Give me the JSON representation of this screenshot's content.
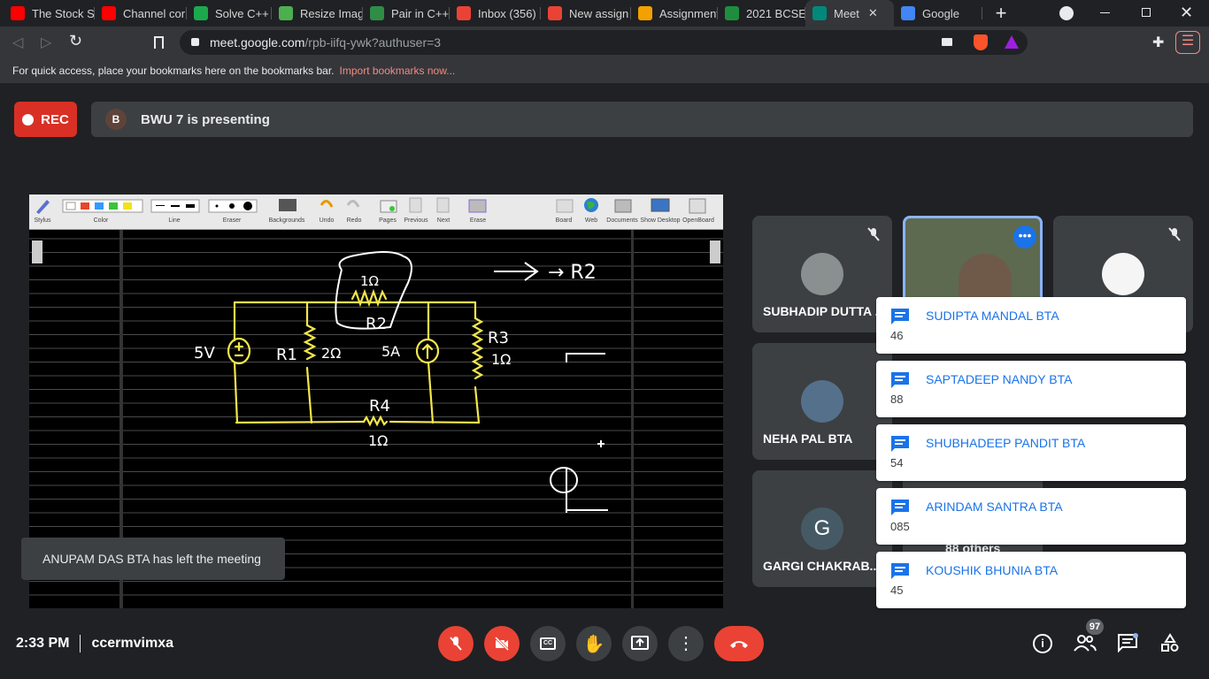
{
  "tabs": [
    {
      "label": "The Stock Sp",
      "icon": "youtube-icon",
      "color": "#ff0000"
    },
    {
      "label": "Channel cor",
      "icon": "youtube-icon",
      "color": "#ff0000"
    },
    {
      "label": "Solve C++ |",
      "icon": "hackerrank-icon",
      "color": "#1ba94c"
    },
    {
      "label": "Resize Imag",
      "icon": "resize-icon",
      "color": "#4caf50"
    },
    {
      "label": "Pair in C++",
      "icon": "gfg-icon",
      "color": "#2f8d46"
    },
    {
      "label": "Inbox (356)",
      "icon": "gmail-icon",
      "color": "#ea4335"
    },
    {
      "label": "New assign",
      "icon": "gmail-icon",
      "color": "#ea4335"
    },
    {
      "label": "Assignment",
      "icon": "classroom-icon",
      "color": "#f4a000"
    },
    {
      "label": "2021 BCSE-",
      "icon": "classroom-icon",
      "color": "#1e8e3e"
    },
    {
      "label": "Meet",
      "icon": "meet-icon",
      "color": "#00897b"
    },
    {
      "label": "Google",
      "icon": "google-icon",
      "color": "#4285f4"
    }
  ],
  "address": {
    "domain": "meet.google.com",
    "path": "/rpb-iifq-ywk?authuser=3"
  },
  "bookmarks": {
    "text": "For quick access, place your bookmarks here on the bookmarks bar.",
    "link": "Import bookmarks now..."
  },
  "meeting": {
    "rec_label": "REC",
    "presenter_initial": "B",
    "presenter_text": "BWU 7 is presenting",
    "time": "2:33 PM",
    "code": "ccermvimxa",
    "people_count": "97",
    "others_label": "88 others"
  },
  "openboard": {
    "tools": [
      "Stylus",
      "Color",
      "Line",
      "Eraser",
      "Backgrounds",
      "Undo",
      "Redo",
      "Pages",
      "Previous",
      "Next",
      "Erase",
      "Board",
      "Web",
      "Documents",
      "Show Desktop",
      "OpenBoard"
    ]
  },
  "participants": [
    {
      "name": "SUBHADIP DUTTA ...",
      "muted": true
    },
    {
      "name": "NEHA PAL BTA",
      "muted": true
    },
    {
      "name": "GARGI CHAKRAB...",
      "initial": "G",
      "muted": true
    }
  ],
  "chat_messages": [
    {
      "sender": "SUDIPTA MANDAL BTA",
      "text": "46"
    },
    {
      "sender": "SAPTADEEP NANDY BTA",
      "text": "88"
    },
    {
      "sender": "SHUBHADEEP PANDIT BTA",
      "text": "54"
    },
    {
      "sender": "ARINDAM SANTRA BTA",
      "text": "085"
    },
    {
      "sender": "KOUSHIK BHUNIA BTA",
      "text": "45"
    }
  ],
  "toast": "ANUPAM DAS BTA has left the meeting",
  "board_labels": {
    "r2_top": "1Ω",
    "r2": "R2",
    "arrow_r2": "→ R2",
    "src_v": "5V",
    "r1": "R1",
    "r1_val": "2Ω",
    "src_a": "5A",
    "r3": "R3",
    "r3_val": "1Ω",
    "r4": "R4",
    "r4_val": "1Ω"
  },
  "colors": {
    "accent_red": "#ea4335",
    "chat_blue": "#1a73e8",
    "wire": "#f3e74a"
  }
}
